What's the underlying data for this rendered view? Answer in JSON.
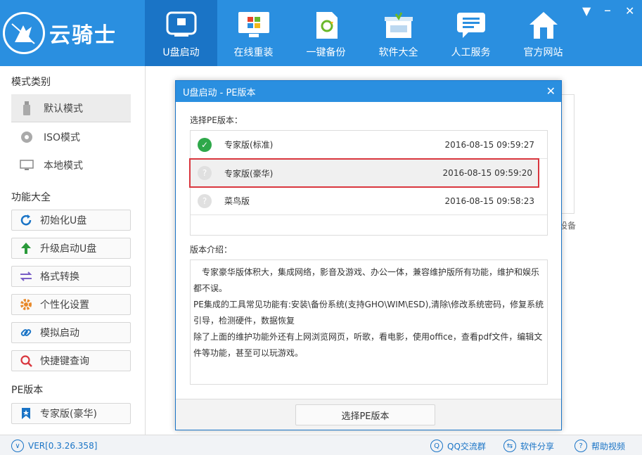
{
  "header": {
    "logo_text": "云骑士",
    "nav": [
      {
        "label": "U盘启动",
        "icon": "usb-icon"
      },
      {
        "label": "在线重装",
        "icon": "windows-icon"
      },
      {
        "label": "一键备份",
        "icon": "backup-icon"
      },
      {
        "label": "软件大全",
        "icon": "software-box-icon"
      },
      {
        "label": "人工服务",
        "icon": "chat-icon"
      },
      {
        "label": "官方网站",
        "icon": "home-icon"
      }
    ],
    "active_tab": "U盘启动"
  },
  "sidebar": {
    "mode_title": "模式类别",
    "modes": [
      {
        "label": "默认模式",
        "icon": "usb-drive-icon"
      },
      {
        "label": "ISO模式",
        "icon": "disc-icon"
      },
      {
        "label": "本地模式",
        "icon": "monitor-icon"
      }
    ],
    "function_title": "功能大全",
    "functions": [
      {
        "label": "初始化U盘",
        "icon": "refresh-icon",
        "color": "#1a74c6"
      },
      {
        "label": "升级启动U盘",
        "icon": "arrow-up-icon",
        "color": "#2a9a3a"
      },
      {
        "label": "格式转换",
        "icon": "swap-icon",
        "color": "#7a5fc6"
      },
      {
        "label": "个性化设置",
        "icon": "gear-icon",
        "color": "#e8892b"
      },
      {
        "label": "模拟启动",
        "icon": "link-icon",
        "color": "#1a74c6"
      },
      {
        "label": "快捷键查询",
        "icon": "search-icon",
        "color": "#d9363e"
      }
    ],
    "pe_title": "PE版本",
    "pe_current": {
      "label": "专家版(豪华)",
      "icon": "bookmark-icon"
    }
  },
  "background": {
    "text_fragment": "设备"
  },
  "dialog": {
    "title": "U盘启动 - PE版本",
    "select_label": "选择PE版本：",
    "versions": [
      {
        "name": "专家版(标准)",
        "time": "2016-08-15 09:59:27",
        "status": "ok"
      },
      {
        "name": "专家版(豪华)",
        "time": "2016-08-15 09:59:20",
        "status": "unknown"
      },
      {
        "name": "菜鸟版",
        "time": "2016-08-15 09:58:23",
        "status": "unknown"
      }
    ],
    "desc_label": "版本介绍：",
    "desc_lines": [
      "专家豪华版体积大，集成网络，影音及游戏、办公一体，兼容维护版所有功能，维护和娱乐都不误。",
      "PE集成的工具常见功能有:安装\\备份系统(支持GHO\\WIM\\ESD),清除\\修改系统密码，修复系统引导，检测硬件，数据恢复",
      "除了上面的维护功能外还有上网浏览网页，听歌，看电影，使用office，查看pdf文件，编辑文件等功能，甚至可以玩游戏。"
    ],
    "confirm_button": "选择PE版本"
  },
  "footer": {
    "version": "VER[0.3.26.358]",
    "qq": "QQ交流群",
    "share": "软件分享",
    "help": "帮助视频"
  },
  "colors": {
    "header_bg": "#2a8fe0",
    "active_tab": "#1a74c6",
    "highlight_border": "#d9363e",
    "ok_green": "#2ea84a"
  }
}
